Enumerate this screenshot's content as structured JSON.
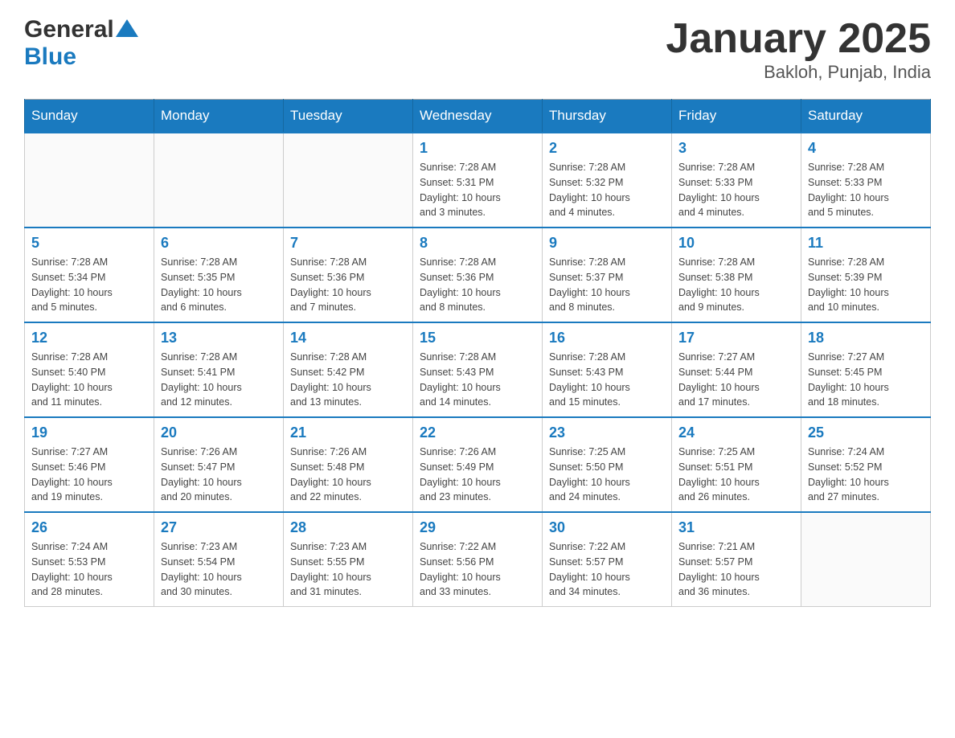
{
  "header": {
    "logo_general": "General",
    "logo_blue": "Blue",
    "title": "January 2025",
    "subtitle": "Bakloh, Punjab, India"
  },
  "weekdays": [
    "Sunday",
    "Monday",
    "Tuesday",
    "Wednesday",
    "Thursday",
    "Friday",
    "Saturday"
  ],
  "weeks": [
    [
      {
        "day": "",
        "info": ""
      },
      {
        "day": "",
        "info": ""
      },
      {
        "day": "",
        "info": ""
      },
      {
        "day": "1",
        "info": "Sunrise: 7:28 AM\nSunset: 5:31 PM\nDaylight: 10 hours\nand 3 minutes."
      },
      {
        "day": "2",
        "info": "Sunrise: 7:28 AM\nSunset: 5:32 PM\nDaylight: 10 hours\nand 4 minutes."
      },
      {
        "day": "3",
        "info": "Sunrise: 7:28 AM\nSunset: 5:33 PM\nDaylight: 10 hours\nand 4 minutes."
      },
      {
        "day": "4",
        "info": "Sunrise: 7:28 AM\nSunset: 5:33 PM\nDaylight: 10 hours\nand 5 minutes."
      }
    ],
    [
      {
        "day": "5",
        "info": "Sunrise: 7:28 AM\nSunset: 5:34 PM\nDaylight: 10 hours\nand 5 minutes."
      },
      {
        "day": "6",
        "info": "Sunrise: 7:28 AM\nSunset: 5:35 PM\nDaylight: 10 hours\nand 6 minutes."
      },
      {
        "day": "7",
        "info": "Sunrise: 7:28 AM\nSunset: 5:36 PM\nDaylight: 10 hours\nand 7 minutes."
      },
      {
        "day": "8",
        "info": "Sunrise: 7:28 AM\nSunset: 5:36 PM\nDaylight: 10 hours\nand 8 minutes."
      },
      {
        "day": "9",
        "info": "Sunrise: 7:28 AM\nSunset: 5:37 PM\nDaylight: 10 hours\nand 8 minutes."
      },
      {
        "day": "10",
        "info": "Sunrise: 7:28 AM\nSunset: 5:38 PM\nDaylight: 10 hours\nand 9 minutes."
      },
      {
        "day": "11",
        "info": "Sunrise: 7:28 AM\nSunset: 5:39 PM\nDaylight: 10 hours\nand 10 minutes."
      }
    ],
    [
      {
        "day": "12",
        "info": "Sunrise: 7:28 AM\nSunset: 5:40 PM\nDaylight: 10 hours\nand 11 minutes."
      },
      {
        "day": "13",
        "info": "Sunrise: 7:28 AM\nSunset: 5:41 PM\nDaylight: 10 hours\nand 12 minutes."
      },
      {
        "day": "14",
        "info": "Sunrise: 7:28 AM\nSunset: 5:42 PM\nDaylight: 10 hours\nand 13 minutes."
      },
      {
        "day": "15",
        "info": "Sunrise: 7:28 AM\nSunset: 5:43 PM\nDaylight: 10 hours\nand 14 minutes."
      },
      {
        "day": "16",
        "info": "Sunrise: 7:28 AM\nSunset: 5:43 PM\nDaylight: 10 hours\nand 15 minutes."
      },
      {
        "day": "17",
        "info": "Sunrise: 7:27 AM\nSunset: 5:44 PM\nDaylight: 10 hours\nand 17 minutes."
      },
      {
        "day": "18",
        "info": "Sunrise: 7:27 AM\nSunset: 5:45 PM\nDaylight: 10 hours\nand 18 minutes."
      }
    ],
    [
      {
        "day": "19",
        "info": "Sunrise: 7:27 AM\nSunset: 5:46 PM\nDaylight: 10 hours\nand 19 minutes."
      },
      {
        "day": "20",
        "info": "Sunrise: 7:26 AM\nSunset: 5:47 PM\nDaylight: 10 hours\nand 20 minutes."
      },
      {
        "day": "21",
        "info": "Sunrise: 7:26 AM\nSunset: 5:48 PM\nDaylight: 10 hours\nand 22 minutes."
      },
      {
        "day": "22",
        "info": "Sunrise: 7:26 AM\nSunset: 5:49 PM\nDaylight: 10 hours\nand 23 minutes."
      },
      {
        "day": "23",
        "info": "Sunrise: 7:25 AM\nSunset: 5:50 PM\nDaylight: 10 hours\nand 24 minutes."
      },
      {
        "day": "24",
        "info": "Sunrise: 7:25 AM\nSunset: 5:51 PM\nDaylight: 10 hours\nand 26 minutes."
      },
      {
        "day": "25",
        "info": "Sunrise: 7:24 AM\nSunset: 5:52 PM\nDaylight: 10 hours\nand 27 minutes."
      }
    ],
    [
      {
        "day": "26",
        "info": "Sunrise: 7:24 AM\nSunset: 5:53 PM\nDaylight: 10 hours\nand 28 minutes."
      },
      {
        "day": "27",
        "info": "Sunrise: 7:23 AM\nSunset: 5:54 PM\nDaylight: 10 hours\nand 30 minutes."
      },
      {
        "day": "28",
        "info": "Sunrise: 7:23 AM\nSunset: 5:55 PM\nDaylight: 10 hours\nand 31 minutes."
      },
      {
        "day": "29",
        "info": "Sunrise: 7:22 AM\nSunset: 5:56 PM\nDaylight: 10 hours\nand 33 minutes."
      },
      {
        "day": "30",
        "info": "Sunrise: 7:22 AM\nSunset: 5:57 PM\nDaylight: 10 hours\nand 34 minutes."
      },
      {
        "day": "31",
        "info": "Sunrise: 7:21 AM\nSunset: 5:57 PM\nDaylight: 10 hours\nand 36 minutes."
      },
      {
        "day": "",
        "info": ""
      }
    ]
  ]
}
